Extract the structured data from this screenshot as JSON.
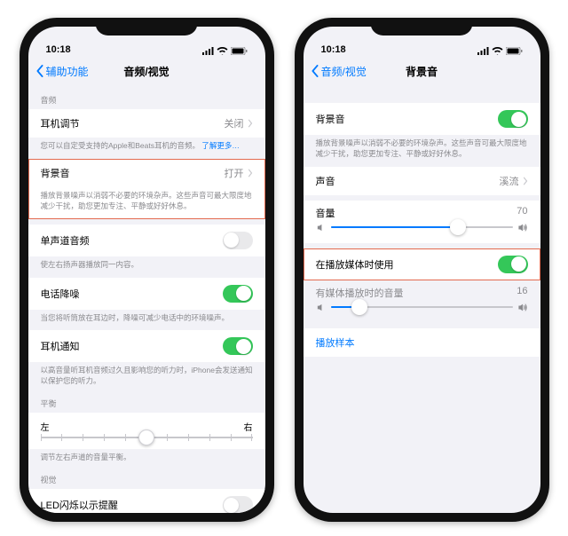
{
  "left": {
    "time": "10:18",
    "back": "辅助功能",
    "title": "音频/视觉",
    "sec_audio": "音频",
    "headphone_adjust": {
      "label": "耳机调节",
      "value": "关闭"
    },
    "headphone_adjust_footer": "您可以自定受支持的Apple和Beats耳机的音频。",
    "learn_more": "了解更多…",
    "bg_sound": {
      "label": "背景音",
      "value": "打开"
    },
    "bg_sound_footer": "播放背景噪声以消弱不必要的环境杂声。这些声音可最大限度地减少干扰，助您更加专注、平静或好好休息。",
    "mono": {
      "label": "单声道音频"
    },
    "mono_footer": "使左右扬声器播放同一内容。",
    "noise_cancel": {
      "label": "电话降噪"
    },
    "noise_cancel_footer": "当您将听筒放在耳边时，降噪可减少电话中的环境噪声。",
    "headphone_notify": {
      "label": "耳机通知"
    },
    "headphone_notify_footer": "以高音量听耳机音频过久且影响您的听力时，iPhone会发送通知以保护您的听力。",
    "balance": {
      "header": "平衡",
      "left": "左",
      "right": "右",
      "pos": 50
    },
    "balance_footer": "调节左右声道的音量平衡。",
    "sec_visual": "视觉",
    "led_flash": {
      "label": "LED闪烁以示提醒"
    }
  },
  "right": {
    "time": "10:18",
    "back": "音频/视觉",
    "title": "背景音",
    "bg_toggle": {
      "label": "背景音"
    },
    "bg_footer": "播放背景噪声以消弱不必要的环境杂声。这些声音可最大限度地减少干扰，助您更加专注、平静或好好休息。",
    "sound": {
      "label": "声音",
      "value": "溪流"
    },
    "volume": {
      "label": "音量",
      "value": 70
    },
    "use_media": {
      "label": "在播放媒体时使用"
    },
    "media_volume": {
      "label": "有媒体播放时的音量",
      "value": 16
    },
    "play_sample": "播放样本"
  }
}
